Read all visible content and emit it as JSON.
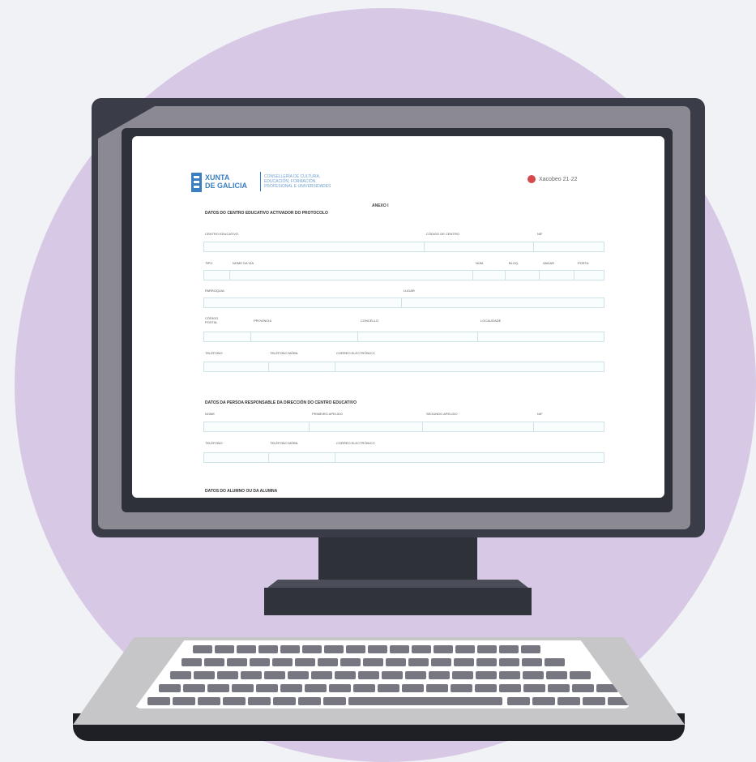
{
  "document": {
    "logo_line1": "XUNTA",
    "logo_line2": "DE GALICIA",
    "dept_line1": "CONSELLERÍA DE CULTURA,",
    "dept_line2": "EDUCACIÓN, FORMACIÓN",
    "dept_line3": "PROFESIONAL E UNIVERSIDADES",
    "right_brand": "Xacobeo 21·22",
    "annex_title": "ANEXO I",
    "section1": "DATOS DO CENTRO EDUCATIVO ACTIVADOR DO PROTOCOLO",
    "row1": [
      "CENTRO EDUCATIVO",
      "CÓDIGO DE CENTRO",
      "NIF"
    ],
    "row2": [
      "TIPO",
      "NOME DA VÍA",
      "NÚM.",
      "BLOQ.",
      "ANDAR",
      "PORTA"
    ],
    "row3": [
      "PARROQUIA",
      "LUGAR"
    ],
    "row4": [
      "CÓDIGO POSTAL",
      "PROVINCIA",
      "CONCELLO",
      "LOCALIDADE"
    ],
    "row5": [
      "TELÉFONO",
      "TELÉFONO MÓBIL",
      "CORREO ELECTRÓNICO"
    ],
    "section2": "DATOS DA PERSOA RESPONSABLE DA DIRECCIÓN DO CENTRO EDUCATIVO",
    "row6": [
      "NOME",
      "PRIMEIRO APELIDO",
      "SEGUNDO APELIDO",
      "NIF"
    ],
    "row7": [
      "TELÉFONO",
      "TELÉFONO MÓBIL",
      "CORREO ELECTRÓNICO"
    ],
    "section3": "DATOS DO ALUMNO OU DA ALUMNA"
  },
  "colors": {
    "background_circle": "#d7c8e5",
    "monitor_frame": "#3a3d47",
    "monitor_bezel": "#8b8a92",
    "brand_blue": "#3a7fc2",
    "field_border": "#cfe3e6"
  }
}
